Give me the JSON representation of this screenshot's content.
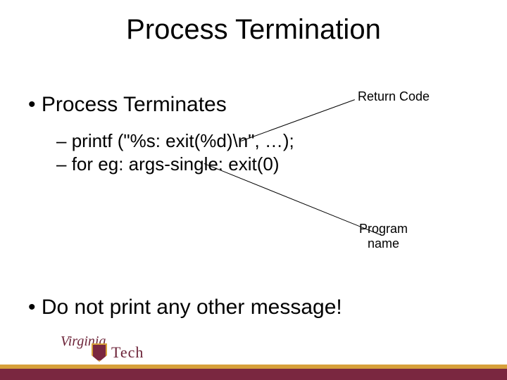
{
  "title": "Process Termination",
  "bullet1": {
    "marker": "•",
    "text": "Process Terminates"
  },
  "sub1": {
    "marker": "–",
    "text": "printf (\"%s: exit(%d)\\n\", …);"
  },
  "sub2": {
    "marker": "–",
    "text": "for eg: args-single: exit(0)"
  },
  "annot1": "Return Code",
  "annot2_line1": "Program",
  "annot2_line2": "name",
  "bullet2": {
    "marker": "•",
    "text": "Do not print any other message!"
  },
  "logo": {
    "top": "Virginia",
    "bottom": "Tech"
  }
}
